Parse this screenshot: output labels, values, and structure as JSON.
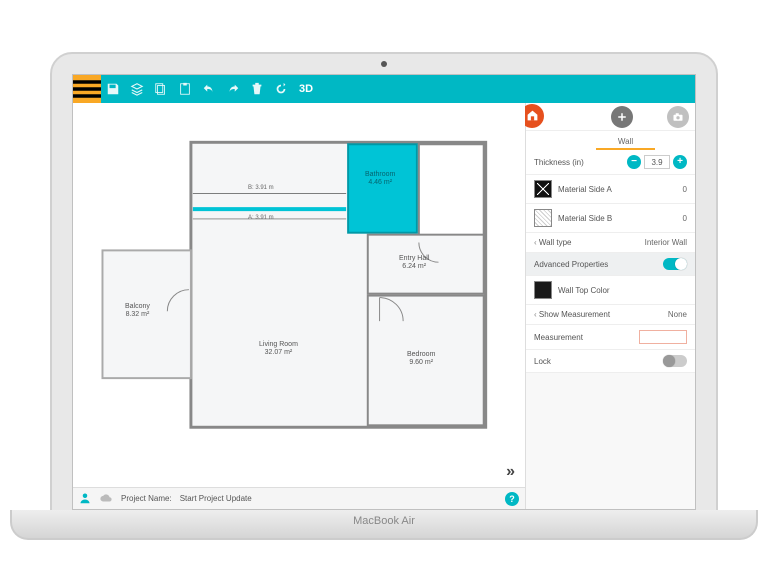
{
  "laptop_brand": "MacBook Air",
  "toolbar": {
    "mode_3d": "3D"
  },
  "panel": {
    "title": "Wall",
    "thickness_label": "Thickness (in)",
    "thickness_value": "3.9",
    "material_a_label": "Material Side A",
    "material_a_value": "0",
    "material_b_label": "Material Side B",
    "material_b_value": "0",
    "wall_type_label": "Wall type",
    "wall_type_value": "Interior Wall",
    "advanced_label": "Advanced Properties",
    "wall_top_label": "Wall Top Color",
    "show_meas_label": "Show Measurement",
    "show_meas_value": "None",
    "measurement_label": "Measurement",
    "lock_label": "Lock"
  },
  "status": {
    "project_label": "Project Name:",
    "project_name": "Start Project Update"
  },
  "rooms": {
    "bathroom": {
      "name": "Bathroom",
      "area": "4.46 m²"
    },
    "entry": {
      "name": "Entry Hall",
      "area": "6.24 m²"
    },
    "living": {
      "name": "Living Room",
      "area": "32.07 m²"
    },
    "bedroom": {
      "name": "Bedroom",
      "area": "9.60 m²"
    },
    "balcony": {
      "name": "Balcony",
      "area": "8.32 m²"
    }
  },
  "dimensions": {
    "b": "B: 3.91 m",
    "a": "A: 3.91 m"
  }
}
